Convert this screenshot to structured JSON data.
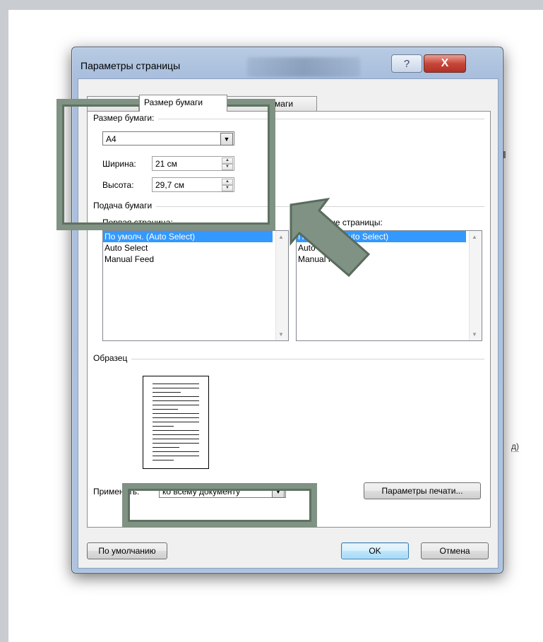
{
  "dialog": {
    "title": "Параметры страницы",
    "help_glyph": "?",
    "close_glyph": "X"
  },
  "tabs": [
    {
      "label": "Поля"
    },
    {
      "label": "Размер бумаги"
    },
    {
      "label": "Источник бумаги"
    }
  ],
  "paper_size": {
    "group_title": "Размер бумаги:",
    "selected": "A4",
    "width_label": "Ширина:",
    "width_value": "21 см",
    "height_label": "Высота:",
    "height_value": "29,7 см"
  },
  "paper_source": {
    "group_title": "Подача бумаги",
    "first_page_label": "Первая страница:",
    "first_page_items": [
      "По умолч. (Auto Select)",
      "Auto Select",
      "Manual Feed"
    ],
    "first_page_selected": 0,
    "other_pages_label": "Остальные страницы:",
    "other_pages_items": [
      "По умолч. (Auto Select)",
      "Auto Select",
      "Manual Feed"
    ],
    "other_pages_selected": 0
  },
  "preview": {
    "group_title": "Образец"
  },
  "apply": {
    "label": "Применить:",
    "value": "ко всему документу"
  },
  "buttons": {
    "print_options": "Параметры печати...",
    "default": "По умолчанию",
    "ok": "OK",
    "cancel": "Отмена"
  },
  "background_doc": {
    "fragment": "д)"
  },
  "colors": {
    "highlight_frame": "#7f9283",
    "selection": "#3399ff",
    "close_button": "#c7473a"
  },
  "icons": [
    "help-icon",
    "close-icon",
    "dropdown-arrow-icon",
    "spin-up-icon",
    "spin-down-icon",
    "arrow-pointer-icon"
  ]
}
